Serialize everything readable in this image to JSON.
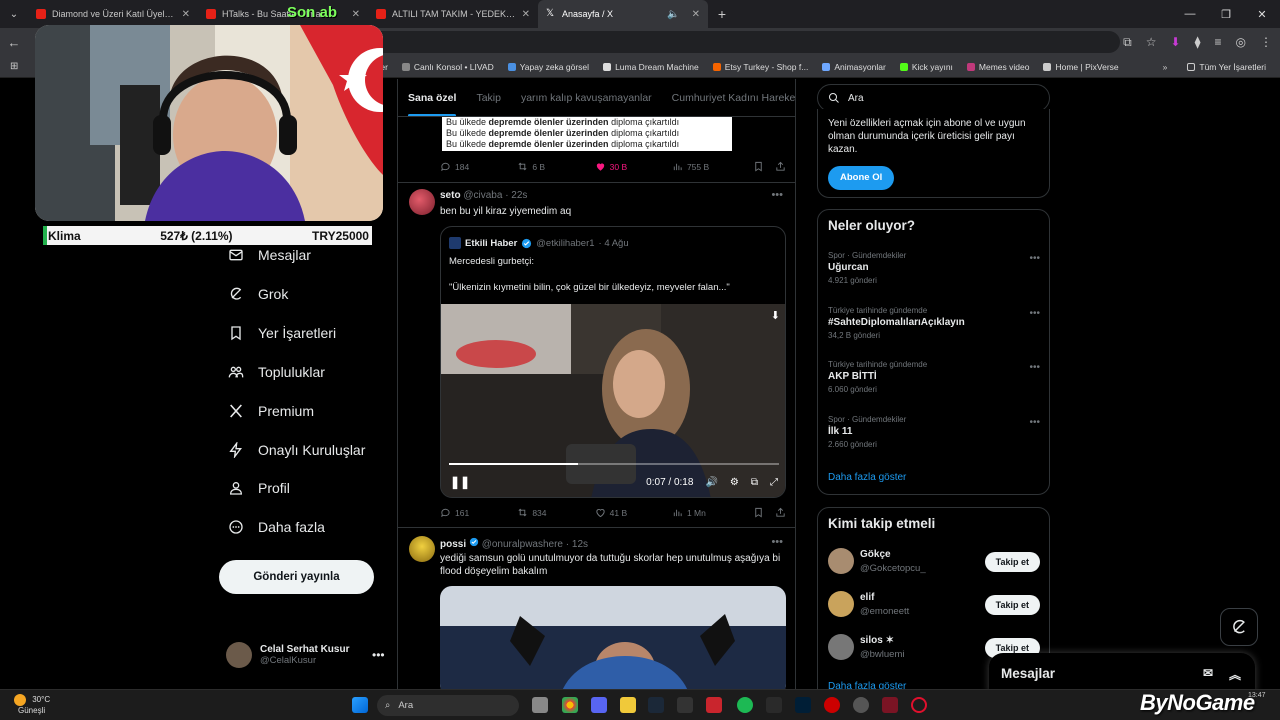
{
  "browser": {
    "tabs": [
      {
        "title": "Diamond ve Üzeri Katıl Üyelerine",
        "favicon_color": "#e62117"
      },
      {
        "title": "HTalks - Bu Saatte Olmaz",
        "favicon_color": "#e62117"
      },
      {
        "title": "ALTILI TAM TAKIM - YEDEK ME",
        "favicon_color": "#e62117"
      },
      {
        "title": "Anasayfa / X",
        "favicon_color": "#ffffff"
      }
    ],
    "bookmarks": [
      "Banner",
      "Canlı Konsol • LIVAD",
      "Yapay zeka görsel",
      "Luma Dream Machine",
      "Etsy Turkey - Shop f...",
      "Animasyonlar",
      "Kick yayını",
      "Memes video",
      "Home | PixVerse"
    ],
    "all_bookmarks": "Tüm Yer İşaretleri"
  },
  "stream_overlay": {
    "top_text": "Son ab",
    "ticker": {
      "name": "Klima",
      "amount": "527₺ (2.11%)",
      "goal": "TRY25000"
    }
  },
  "sidebar": {
    "items": [
      {
        "label": "Mesajlar",
        "icon": "mail-icon"
      },
      {
        "label": "Grok",
        "icon": "grok-icon"
      },
      {
        "label": "Yer İşaretleri",
        "icon": "bookmark-icon"
      },
      {
        "label": "Topluluklar",
        "icon": "communities-icon"
      },
      {
        "label": "Premium",
        "icon": "x-logo-icon"
      },
      {
        "label": "Onaylı Kuruluşlar",
        "icon": "lightning-icon"
      },
      {
        "label": "Profil",
        "icon": "profile-icon"
      },
      {
        "label": "Daha fazla",
        "icon": "more-circle-icon"
      }
    ],
    "post_button": "Gönderi yayınla",
    "account": {
      "name": "Celal Serhat Kusur",
      "handle": "@CelalKusur"
    }
  },
  "feed": {
    "tabs": [
      "Sana özel",
      "Takip",
      "yarım kalıp kavuşamayanlar",
      "Cumhuriyet Kadını Hareke"
    ],
    "snippet_lines": [
      {
        "a": "Bu ülkede ",
        "b": "depremde ölenler üzerinden",
        "c": " diploma çıkartıldı"
      },
      {
        "a": "Bu ülkede ",
        "b": "depremde ölenler üzerinden",
        "c": " diploma çıkartıldı"
      },
      {
        "a": "Bu ülkede ",
        "b": "depremde ölenler üzerinden",
        "c": " diploma çıkartıldı"
      }
    ],
    "post0_actions": {
      "replies": "184",
      "reposts": "6 B",
      "likes": "30 B",
      "views": "755 B"
    },
    "post1": {
      "name": "seto",
      "handle": "@civaba",
      "time": "· 22s",
      "text": "ben bu yil kiraz yiyemedim aq",
      "quote": {
        "name": "Etkili Haber",
        "handle": "@etkilihaber1",
        "time": "· 4 Ağu",
        "line1": "Mercedesli gurbetçi:",
        "line2": "\"Ülkenizin kıymetini bilin, çok güzel bir ülkedeyiz, meyveler falan...\"",
        "video_time": "0:07 / 0:18",
        "progress": 0.39
      },
      "actions": {
        "replies": "161",
        "reposts": "834",
        "likes": "41 B",
        "views": "1 Mn"
      }
    },
    "post2": {
      "name": "possi",
      "handle": "@onuralpwashere",
      "time": "· 12s",
      "text": "yediği samsun golü unutulmuyor da tuttuğu skorlar hep unutulmuş aşağıya bi flood döşeyelim bakalım"
    }
  },
  "right": {
    "search_placeholder": "Ara",
    "premium": {
      "text": "Yeni özellikleri açmak için abone ol ve uygun olman durumunda içerik üreticisi gelir payı kazan.",
      "button": "Abone Ol"
    },
    "trends": {
      "title": "Neler oluyor?",
      "items": [
        {
          "category": "Spor · Gündemdekiler",
          "title": "Uğurcan",
          "count": "4.921 gönderi"
        },
        {
          "category": "Türkiye tarihinde gündemde",
          "title": "#SahteDiplomalılarıAçıklayın",
          "count": "34,2 B gönderi"
        },
        {
          "category": "Türkiye tarihinde gündemde",
          "title": "AKP BİTTİ",
          "count": "6.060 gönderi"
        },
        {
          "category": "Spor · Gündemdekiler",
          "title": "İlk 11",
          "count": "2.660 gönderi"
        }
      ],
      "show_more": "Daha fazla göster"
    },
    "who_to_follow": {
      "title": "Kimi takip etmeli",
      "items": [
        {
          "name": "Gökçe",
          "handle": "@Gokcetopcu_",
          "button": "Takip et"
        },
        {
          "name": "elif",
          "handle": "@emoneett",
          "button": "Takip et"
        },
        {
          "name": "silos ✶",
          "handle": "@bwluemi",
          "button": "Takip et"
        }
      ],
      "show_more": "Daha fazla göster"
    },
    "messages_drawer": "Mesajlar"
  },
  "taskbar": {
    "weather_temp": "30°C",
    "weather_desc": "Güneşli",
    "search_placeholder": "Ara",
    "time": "13:47"
  },
  "watermark": "ByNoGame",
  "colors": {
    "accent": "#1d9bf0",
    "like": "#f91880",
    "bg": "#000000",
    "border": "#2f3336"
  }
}
